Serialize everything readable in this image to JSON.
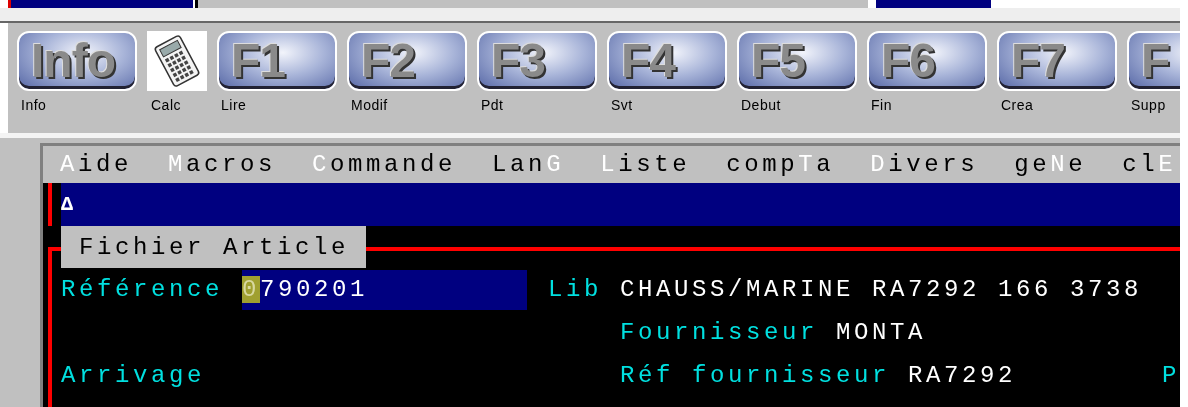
{
  "toolbar": [
    {
      "kind": "key",
      "text": "Info",
      "label": "Info"
    },
    {
      "kind": "calculator",
      "label": "Calc"
    },
    {
      "kind": "key",
      "text": "F1",
      "label": "Lire"
    },
    {
      "kind": "key",
      "text": "F2",
      "label": "Modif"
    },
    {
      "kind": "key",
      "text": "F3",
      "label": "Pdt"
    },
    {
      "kind": "key",
      "text": "F4",
      "label": "Svt"
    },
    {
      "kind": "key",
      "text": "F5",
      "label": "Debut"
    },
    {
      "kind": "key",
      "text": "F6",
      "label": "Fin"
    },
    {
      "kind": "key",
      "text": "F7",
      "label": "Crea"
    },
    {
      "kind": "key",
      "text": "F",
      "label": "Supp"
    }
  ],
  "menu": [
    {
      "key": "A",
      "after": "ide"
    },
    {
      "key": "M",
      "after": "acros"
    },
    {
      "key": "C",
      "after": "ommande"
    },
    {
      "before": "Lan",
      "key": "G"
    },
    {
      "key": "L",
      "after": "iste"
    },
    {
      "before": "comp",
      "key": "T",
      "after": "a"
    },
    {
      "key": "D",
      "after": "ivers"
    },
    {
      "before": "ge",
      "key": "N",
      "after": "e"
    },
    {
      "before": "cl",
      "key": "E"
    }
  ],
  "prompt": "Δ",
  "form": {
    "title": "Fichier Article",
    "reference": {
      "label": "Référence",
      "value": "0790201",
      "cursor": true
    },
    "lib": {
      "label": "Lib",
      "value": "CHAUSS/MARINE RA7292 166 3738"
    },
    "fournisseur": {
      "label": "Fournisseur",
      "value": "MONTA"
    },
    "arrivage": {
      "label": "Arrivage"
    },
    "ref_fournisseur": {
      "label": "Réf fournisseur",
      "value": "RA7292"
    },
    "column_3": {
      "label": "P"
    }
  }
}
